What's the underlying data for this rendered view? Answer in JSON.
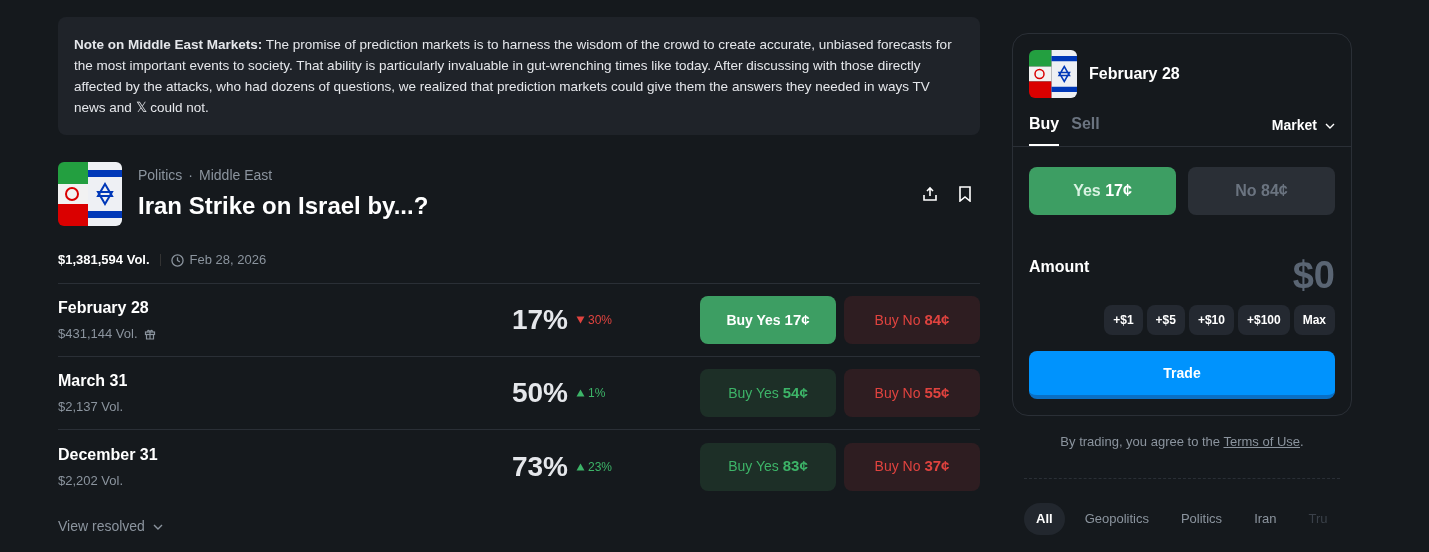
{
  "note": "**Note on Middle East Markets:** The promise of prediction markets is to harness the wisdom of the crowd to create accurate, unbiased forecasts for the most important events to society. That ability is particularly invaluable in gut-wrenching times like today. After discussing with those directly affected by the attacks, who had dozens of questions, we realized that prediction markets could give them the answers they needed in ways TV news and 𝕏 could not.",
  "event": {
    "breadcrumbs": [
      "Politics",
      "Middle East"
    ],
    "separator": "·",
    "title": "Iran Strike on Israel by...?",
    "volume": "$1,381,594 Vol.",
    "end_date": "Feb 28, 2026"
  },
  "markets": [
    {
      "name": "February 28",
      "volume": "$431,144 Vol.",
      "has_reward": true,
      "chance": "17%",
      "change": "30%",
      "kind": "down",
      "yes_label": "Buy Yes",
      "yes_price": "17¢",
      "no_label": "Buy No",
      "no_price": "84¢",
      "selected": true
    },
    {
      "name": "March 31",
      "volume": "$2,137 Vol.",
      "has_reward": false,
      "chance": "50%",
      "change": "1%",
      "kind": "up",
      "yes_label": "Buy Yes",
      "yes_price": "54¢",
      "no_label": "Buy No",
      "no_price": "55¢",
      "selected": false
    },
    {
      "name": "December 31",
      "volume": "$2,202 Vol.",
      "has_reward": false,
      "chance": "73%",
      "change": "23%",
      "kind": "up",
      "yes_label": "Buy Yes",
      "yes_price": "83¢",
      "no_label": "Buy No",
      "no_price": "37¢",
      "selected": false
    }
  ],
  "view_resolved": "View resolved",
  "trade_panel": {
    "title": "February 28",
    "tabs": [
      {
        "label": "Buy",
        "selected": true
      },
      {
        "label": "Sell",
        "selected": false
      }
    ],
    "order_type": "Market",
    "outcomes": [
      {
        "label": "Yes",
        "price": "17¢",
        "kind": "yes",
        "selected": true
      },
      {
        "label": "No",
        "price": "84¢",
        "kind": "no",
        "selected": false
      }
    ],
    "amount_label": "Amount",
    "amount": "$0",
    "increments": [
      "+$1",
      "+$5",
      "+$10",
      "+$100",
      "Max"
    ],
    "trade_button": "Trade"
  },
  "terms": {
    "text": "By trading, you agree to the",
    "link": "Terms of Use",
    "end": "."
  },
  "tags": [
    {
      "label": "All",
      "selected": true
    },
    {
      "label": "Geopolitics",
      "selected": false
    },
    {
      "label": "Politics",
      "selected": false
    },
    {
      "label": "Iran",
      "selected": false
    },
    {
      "label": "Tru",
      "selected": false
    }
  ]
}
